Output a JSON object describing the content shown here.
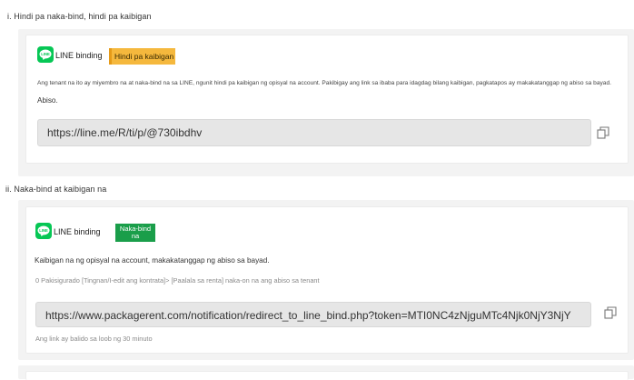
{
  "section1": {
    "title": "i. Hindi pa naka-bind, hindi pa kaibigan",
    "line_label": "LINE binding",
    "status_badge": "Hindi pa kaibigan",
    "description": "Ang tenant na ito ay miyembro na at naka-bind na sa LINE, ngunit hindi pa kaibigan ng opisyal na account. Pakibigay ang link sa ibaba para idagdag bilang kaibigan, pagkatapos ay makakatanggap ng abiso sa bayad.",
    "notice_label": "Abiso.",
    "url": "https://line.me/R/ti/p/@730ibdhv"
  },
  "section2": {
    "title": "ii. Naka-bind at kaibigan na",
    "line_label": "LINE binding",
    "status_badge": "Naka-bind na",
    "description": "Kaibigan na ng opisyal na account, makakatanggap ng abiso sa bayad.",
    "instruction": "0 Pakisigurado [Tingnan/I-edit ang kontrata]> [Paalala sa renta] naka-on na ang abiso sa tenant",
    "url": "https://www.packagerent.com/notification/redirect_to_line_bind.php?token=MTI0NC4zNjguMTc4Njk0NjY3NjY",
    "validity_note": "Ang link ay balido sa loob ng 30 minuto"
  },
  "colors": {
    "line_green": "#06c755",
    "badge_yellow": "#f5b83d",
    "badge_green": "#1a9e4a"
  },
  "icons": {
    "line_logo": "line-logo-icon",
    "copy": "copy-icon"
  }
}
